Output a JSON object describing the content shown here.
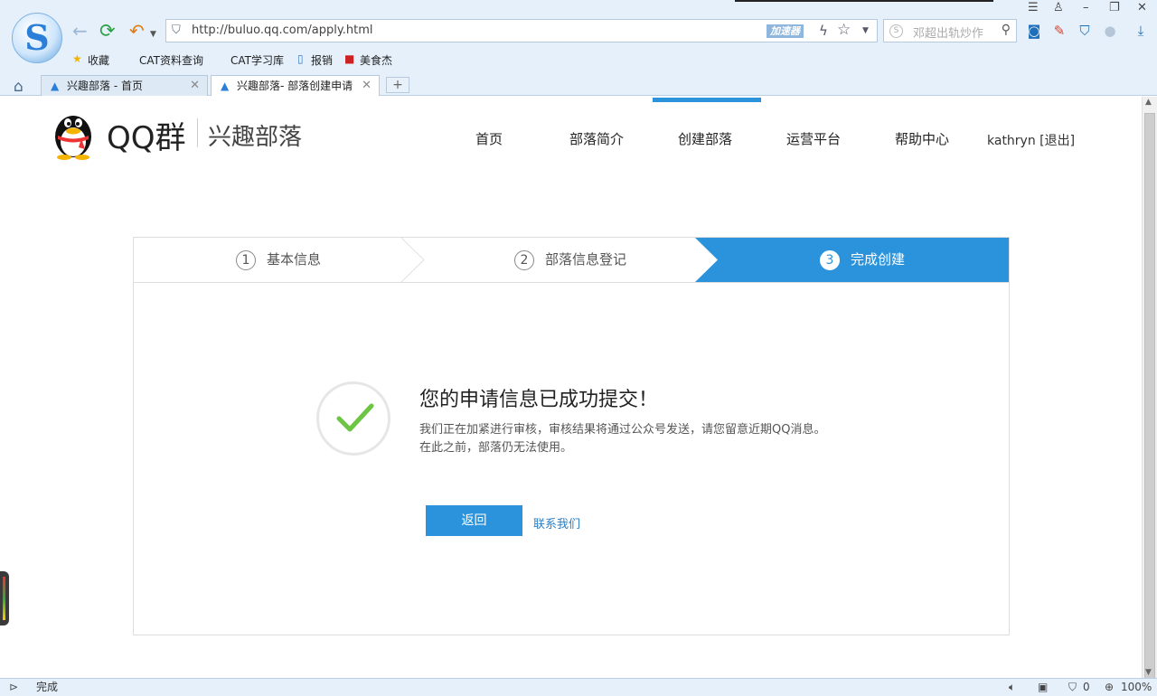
{
  "browser": {
    "url": "http://buluo.qq.com/apply.html",
    "accelerator": "加速器",
    "search_placeholder": "邓超出轨炒作",
    "bookmarks": [
      "收藏",
      "CAT资料查询",
      "CAT学习库",
      "报销",
      "美食杰"
    ],
    "tabs": [
      {
        "label": "兴趣部落 - 首页"
      },
      {
        "label": "兴趣部落- 部落创建申请"
      }
    ],
    "status": {
      "text": "完成",
      "count": "0",
      "zoom": "100%"
    }
  },
  "site": {
    "brand": "QQ群",
    "subtitle": "兴趣部落",
    "nav": [
      "首页",
      "部落简介",
      "创建部落",
      "运营平台",
      "帮助中心"
    ],
    "active_nav": "创建部落",
    "user": "kathryn",
    "logout": "[退出]"
  },
  "steps": [
    {
      "num": "1",
      "label": "基本信息"
    },
    {
      "num": "2",
      "label": "部落信息登记"
    },
    {
      "num": "3",
      "label": "完成创建"
    }
  ],
  "result": {
    "title": "您的申请信息已成功提交！",
    "line1": "我们正在加紧进行审核，审核结果将通过公众号发送，请您留意近期QQ消息。",
    "line2": "在此之前，部落仍无法使用。",
    "back": "返回",
    "contact": "联系我们"
  },
  "colors": {
    "accent": "#2a93dc",
    "check": "#6cc644"
  }
}
